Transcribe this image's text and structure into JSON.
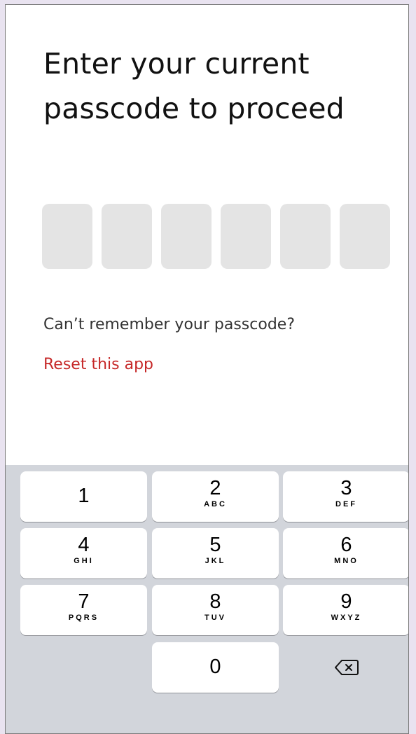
{
  "prompt": {
    "title": "Enter your current passcode to proceed",
    "code_length": 6
  },
  "help": {
    "question": "Can’t remember your passcode?",
    "reset_link": "Reset this app"
  },
  "keypad": {
    "keys": [
      {
        "digit": "1",
        "letters": ""
      },
      {
        "digit": "2",
        "letters": "ABC"
      },
      {
        "digit": "3",
        "letters": "DEF"
      },
      {
        "digit": "4",
        "letters": "GHI"
      },
      {
        "digit": "5",
        "letters": "JKL"
      },
      {
        "digit": "6",
        "letters": "MNO"
      },
      {
        "digit": "7",
        "letters": "PQRS"
      },
      {
        "digit": "8",
        "letters": "TUV"
      },
      {
        "digit": "9",
        "letters": "WXYZ"
      },
      {
        "digit": "0",
        "letters": ""
      }
    ],
    "delete_icon": "backspace-icon"
  },
  "colors": {
    "link": "#c62828",
    "code_box": "#e4e4e4",
    "keypad_bg": "#d2d5db"
  }
}
